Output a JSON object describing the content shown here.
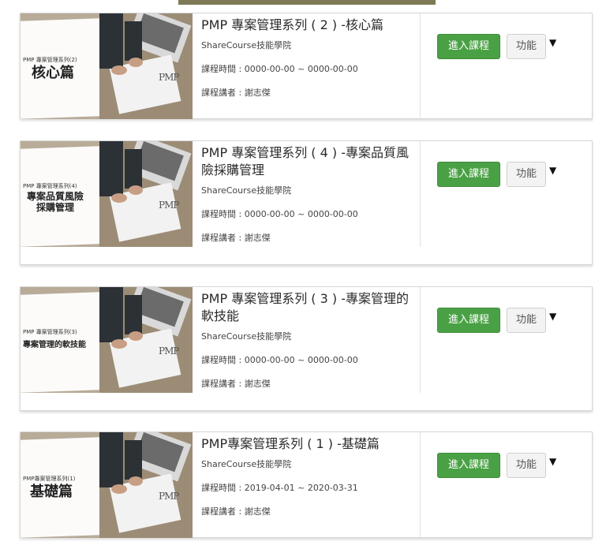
{
  "courses": [
    {
      "series_label": "PMP 專案管理系列(2)",
      "thumb_title": "核心篇",
      "title": "PMP 專案管理系列 ( 2 ) -核心篇",
      "org": "ShareCourse技能學院",
      "period": "課程時間 : 0000-00-00 ~ 0000-00-00",
      "teacher": "課程講者 : 謝志傑",
      "enter_label": "進入課程",
      "func_label": "功能",
      "caret": "▼"
    },
    {
      "series_label": "PMP 專案管理系列(4)",
      "thumb_title": "專案品質風險\n採購管理",
      "title": "PMP 專案管理系列 ( 4 ) -專案品質風險採購管理",
      "org": "ShareCourse技能學院",
      "period": "課程時間 : 0000-00-00 ~ 0000-00-00",
      "teacher": "課程講者 : 謝志傑",
      "enter_label": "進入課程",
      "func_label": "功能",
      "caret": "▼"
    },
    {
      "series_label": "PMP 專案管理系列(3)",
      "thumb_title": "專案管理的軟技能",
      "title": "PMP 專案管理系列 ( 3 ) -專案管理的軟技能",
      "org": "ShareCourse技能學院",
      "period": "課程時間 : 0000-00-00 ~ 0000-00-00",
      "teacher": "課程講者 : 謝志傑",
      "enter_label": "進入課程",
      "func_label": "功能",
      "caret": "▼"
    },
    {
      "series_label": "PMP專案管理系列(1)",
      "thumb_title": "基礎篇",
      "title": "PMP專案管理系列 ( 1 ) -基礎篇",
      "org": "ShareCourse技能學院",
      "period": "課程時間 : 2019-04-01 ~ 2020-03-31",
      "teacher": "課程講者 : 謝志傑",
      "enter_label": "進入課程",
      "func_label": "功能",
      "caret": "▼"
    }
  ],
  "thumb_logo": "PMP",
  "colors": {
    "enter_button": "#4aa145",
    "top_bar": "#7d7a55"
  }
}
